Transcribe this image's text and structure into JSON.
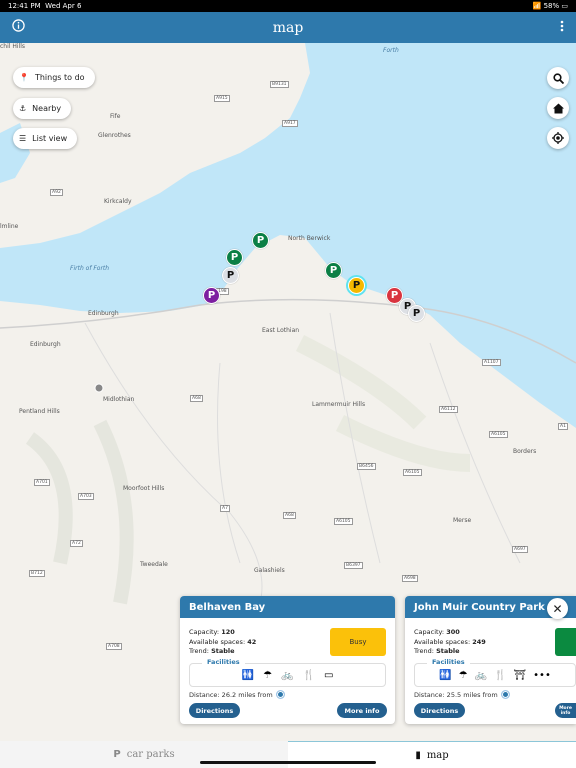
{
  "status_bar": {
    "time": "12:41 PM",
    "date": "Wed Apr 6",
    "battery": "58%"
  },
  "header": {
    "title": "map",
    "info_icon": "info-icon",
    "menu_icon": "more-vertical-icon"
  },
  "map_controls": {
    "things_to_do": "Things to do",
    "nearby": "Nearby",
    "list_view": "List view",
    "right_buttons": [
      "search-icon",
      "home-icon",
      "locate-icon"
    ]
  },
  "map_labels": {
    "places": [
      "Forth",
      "Fife",
      "Glenrothes",
      "Kirkcaldy",
      "Firth of Forth",
      "Edinburgh",
      "North Berwick",
      "East Lothian",
      "Midlothian",
      "Lammermuir Hills",
      "Borders",
      "Moorfoot Hills",
      "Galashiels",
      "Tweedale",
      "Merse",
      "Pentland Hills",
      "Edinburgh",
      "lmline",
      "chil Hills"
    ],
    "roads": [
      "A915",
      "B9131",
      "A917",
      "A92",
      "A198",
      "A68",
      "A7",
      "A1107",
      "A6112",
      "A6105",
      "A1",
      "B6456",
      "A6105",
      "A701",
      "A703",
      "A72",
      "B712",
      "A708",
      "A68",
      "A6105",
      "B6397",
      "A698",
      "A697"
    ]
  },
  "markers": [
    {
      "color": "#0b7f45",
      "label": "P"
    },
    {
      "color": "#0b7f45",
      "label": "P"
    },
    {
      "color": "#dde0e5",
      "label": "P"
    },
    {
      "color": "#7d1fa0",
      "label": "P"
    },
    {
      "color": "#0b7f45",
      "label": "P"
    },
    {
      "color": "#f5b800",
      "label": "P",
      "selected": true
    },
    {
      "color": "#d9343f",
      "label": "P"
    },
    {
      "color": "#dde0e5",
      "label": "P"
    },
    {
      "color": "#dde0e5",
      "label": "P"
    }
  ],
  "cards": [
    {
      "name": "Belhaven Bay",
      "capacity_label": "Capacity:",
      "capacity": "120",
      "available_label": "Available spaces:",
      "available": "42",
      "trend_label": "Trend:",
      "trend": "Stable",
      "status": "Busy",
      "status_color": "#fbc10a",
      "facilities_label": "Facilities",
      "facilities": [
        "toilets-icon",
        "shower-icon",
        "cycle-icon",
        "food-icon",
        "card-payment-icon"
      ],
      "distance": "Distance:  26.2 miles from",
      "directions": "Directions",
      "more_info": "More info"
    },
    {
      "name": "John Muir Country Park",
      "capacity_label": "Capacity:",
      "capacity": "300",
      "available_label": "Available spaces:",
      "available": "249",
      "trend_label": "Trend:",
      "trend": "Stable",
      "status": "",
      "status_color": "#0b8a40",
      "facilities_label": "Facilities",
      "facilities": [
        "toilets-icon",
        "shower-icon",
        "cycle-icon",
        "food-icon",
        "picnic-icon",
        "more-icon"
      ],
      "distance": "Distance:  25.5 miles from",
      "directions": "Directions",
      "more_info": "More info"
    }
  ],
  "tabs": [
    {
      "label": "car parks",
      "icon": "P",
      "active": false
    },
    {
      "label": "map",
      "active": true
    }
  ],
  "colors": {
    "brand": "#2e79ac",
    "sea": "#c0e6f8",
    "land": "#f3f1ec"
  }
}
